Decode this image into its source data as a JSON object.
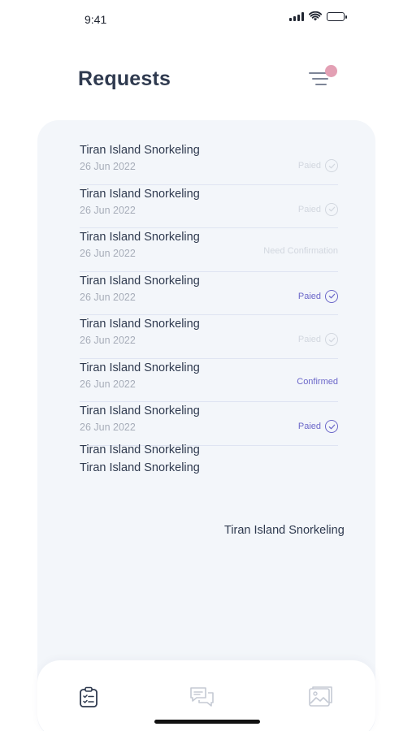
{
  "status_bar": {
    "time": "9:41"
  },
  "header": {
    "title": "Requests"
  },
  "requests": [
    {
      "title": "Tiran Island Snorkeling",
      "date": "26 Jun 2022",
      "status": "Paied",
      "status_style": "faded",
      "check": true
    },
    {
      "title": "Tiran Island Snorkeling",
      "date": "26 Jun 2022",
      "status": "Paied",
      "status_style": "faded",
      "check": true
    },
    {
      "title": "Tiran Island Snorkeling",
      "date": "26 Jun 2022",
      "status": "Need Confirmation",
      "status_style": "faded",
      "check": false
    },
    {
      "title": "Tiran Island Snorkeling",
      "date": "26 Jun 2022",
      "status": "Paied",
      "status_style": "active",
      "check": true
    },
    {
      "title": "Tiran Island Snorkeling",
      "date": "26 Jun 2022",
      "status": "Paied",
      "status_style": "faded",
      "check": true
    },
    {
      "title": "Tiran Island Snorkeling",
      "date": "26 Jun 2022",
      "status": "Confirmed",
      "status_style": "active",
      "check": false
    },
    {
      "title": "Tiran Island Snorkeling",
      "date": "26 Jun 2022",
      "status": "Paied",
      "status_style": "active",
      "check": true
    }
  ],
  "extra_lines": [
    "Tiran Island Snorkeling",
    "Tiran Island Snorkeling"
  ],
  "extra_right": "Tiran Island Snorkeling",
  "nav": [
    {
      "icon": "clipboard-list-icon",
      "active": true
    },
    {
      "icon": "chat-bubbles-icon",
      "active": false
    },
    {
      "icon": "gallery-icon",
      "active": false
    }
  ],
  "colors": {
    "accent": "#6b67c9",
    "faded_status": "#d2d7df",
    "notification_dot": "#e3a0b4",
    "card_background": "#f3f6fa"
  }
}
